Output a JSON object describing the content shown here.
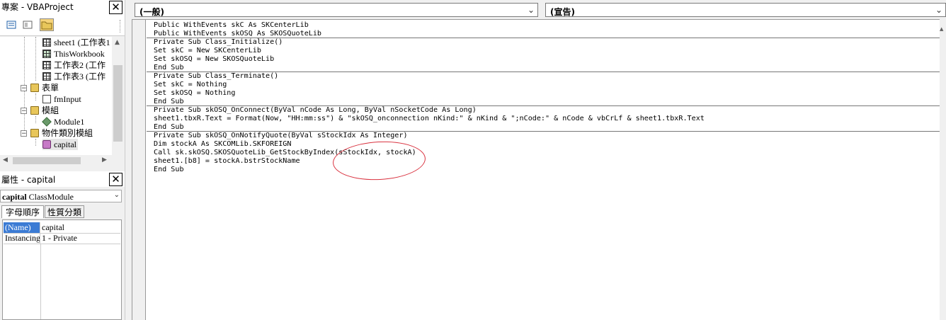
{
  "project_pane": {
    "title": "專案 - VBAProject",
    "tree": [
      {
        "label": "sheet1 (工作表1",
        "icon": "worksheet-icon"
      },
      {
        "label": "ThisWorkbook",
        "icon": "workbook-icon"
      },
      {
        "label": "工作表2 (工作",
        "icon": "worksheet-icon"
      },
      {
        "label": "工作表3 (工作",
        "icon": "worksheet-icon"
      },
      {
        "label": "表單",
        "icon": "folder-icon"
      },
      {
        "label": "fmInput",
        "icon": "form-icon"
      },
      {
        "label": "模組",
        "icon": "folder-icon"
      },
      {
        "label": "Module1",
        "icon": "module-icon"
      },
      {
        "label": "物件類別模組",
        "icon": "folder-icon"
      },
      {
        "label": "capital",
        "icon": "class-module-icon"
      }
    ]
  },
  "properties_pane": {
    "title": "屬性 - capital",
    "object_name": "capital",
    "object_type": "ClassModule",
    "tabs": [
      "字母順序",
      "性質分類"
    ],
    "rows": [
      {
        "name": "(Name)",
        "value": "capital"
      },
      {
        "name": "Instancing",
        "value": "1 - Private"
      }
    ]
  },
  "code_window": {
    "object_combo": "(一般)",
    "procedure_combo": "(宣告)",
    "lines": [
      "Public WithEvents skC As SKCenterLib",
      "Public WithEvents skOSQ As SKOSQuoteLib",
      "Private Sub Class_Initialize()",
      "Set skC = New SKCenterLib",
      "Set skOSQ = New SKOSQuoteLib",
      "End Sub",
      "Private Sub Class_Terminate()",
      "Set skC = Nothing",
      "Set skOSQ = Nothing",
      "End Sub",
      "Private Sub skOSQ_OnConnect(ByVal nCode As Long, ByVal nSocketCode As Long)",
      "sheet1.tbxR.Text = Format(Now, \"HH:mm:ss\") & \"skOSQ_onconnection nKind:\" & nKind & \";nCode:\" & nCode & vbCrLf & sheet1.tbxR.Text",
      "End Sub",
      "Private Sub skOSQ_OnNotifyQuote(ByVal sStockIdx As Integer)",
      "Dim stockA As SKCOMLib.SKFOREIGN",
      "Call sk.skOSQ.SKOSQuoteLib_GetStockByIndex(sStockIdx, stockA)",
      "sheet1.[b8] = stockA.bstrStockName",
      "End Sub"
    ],
    "annotation_color": "#d9323f"
  }
}
